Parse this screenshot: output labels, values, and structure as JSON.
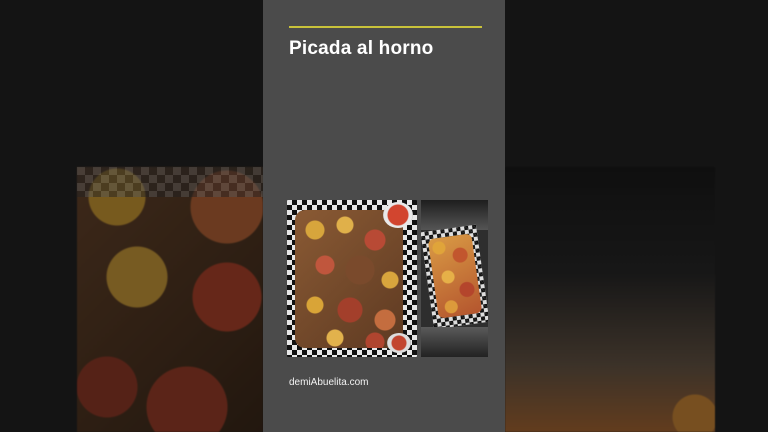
{
  "post": {
    "title": "Picada al horno",
    "credit": "demiAbuelita.com"
  },
  "colors": {
    "panel": "#4b4b4b",
    "accent_line": "#c9c23a",
    "background": "#121212"
  },
  "images": {
    "main_photo": "picada-tray-photo",
    "second_photo": "picada-foil-tray-photo",
    "background_left": "blurred-food-background",
    "background_right": "blurred-food-background"
  }
}
